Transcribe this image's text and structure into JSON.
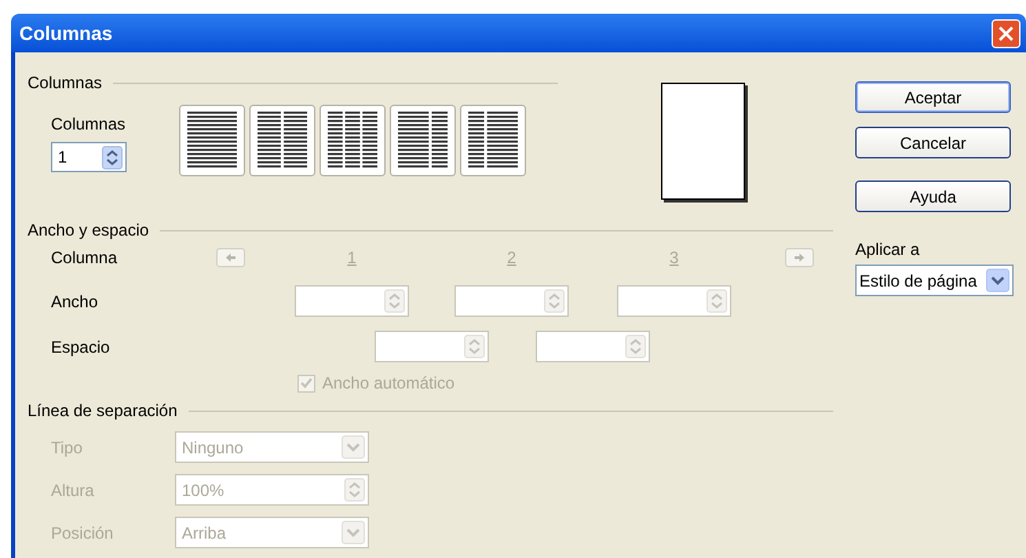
{
  "window": {
    "title": "Columnas"
  },
  "columns_section": {
    "heading": "Columnas",
    "count_label": "Columnas",
    "count_value": "1",
    "presets": [
      {
        "kind": "single"
      },
      {
        "kind": "double"
      },
      {
        "kind": "triple"
      },
      {
        "kind": "leftwide"
      },
      {
        "kind": "rightwide"
      }
    ]
  },
  "width_spacing": {
    "heading": "Ancho y espacio",
    "column_label": "Columna",
    "column_numbers": [
      "1",
      "2",
      "3"
    ],
    "width_label": "Ancho",
    "width_fields": [
      {
        "disabled": true
      },
      {
        "disabled": true
      },
      {
        "disabled": true
      }
    ],
    "spacing_label": "Espacio",
    "spacing_fields": [
      {
        "disabled": true
      },
      {
        "disabled": true
      }
    ],
    "auto_width": {
      "label": "Ancho automático",
      "checked": true,
      "disabled": true
    }
  },
  "separator": {
    "heading": "Línea de separación",
    "rows": [
      {
        "kind": "dropdown",
        "label": "Tipo",
        "value": "Ninguno",
        "disabled": true
      },
      {
        "kind": "spin",
        "label": "Altura",
        "value": "100%",
        "disabled": true
      },
      {
        "kind": "dropdown",
        "label": "Posición",
        "value": "Arriba",
        "disabled": true
      }
    ]
  },
  "buttons": [
    {
      "label": "Aceptar",
      "default": true
    },
    {
      "label": "Cancelar",
      "default": false
    },
    {
      "label": "Ayuda",
      "default": false
    }
  ],
  "apply_to": {
    "label": "Aplicar a",
    "value": "Estilo de página"
  }
}
